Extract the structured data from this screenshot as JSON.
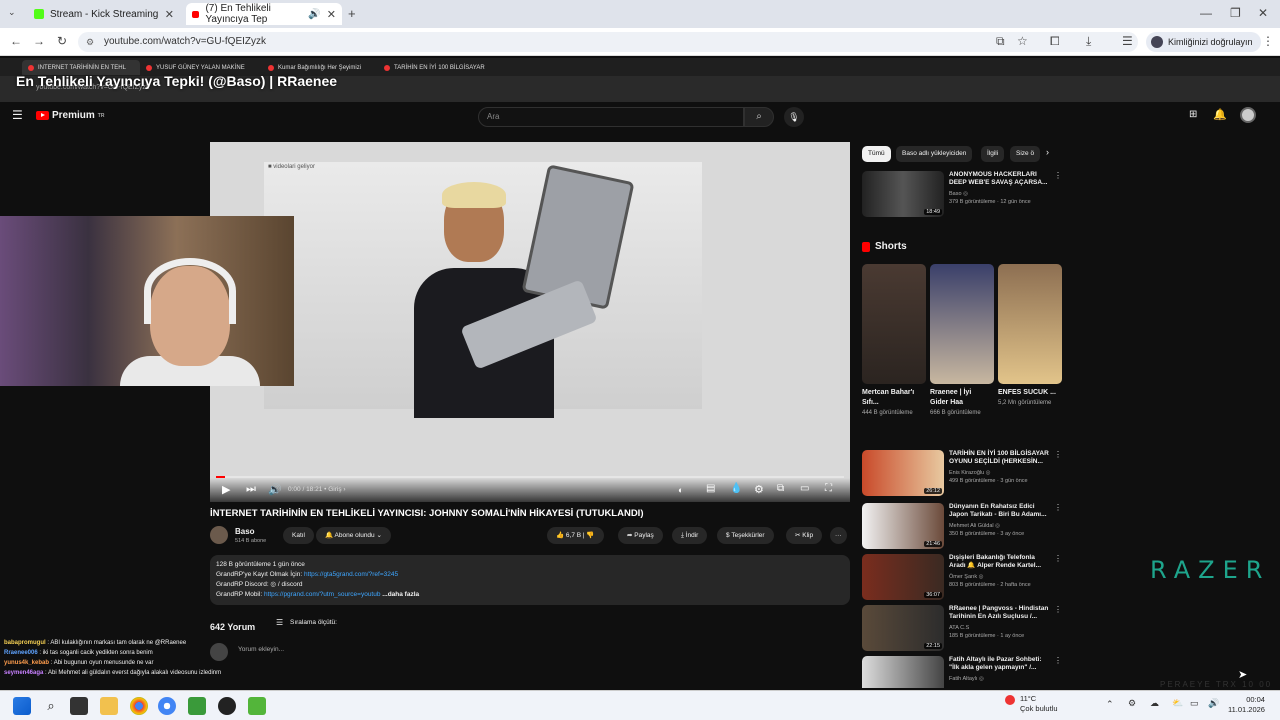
{
  "outer_browser": {
    "tabs": [
      {
        "label": "Stream - Kick Streaming"
      },
      {
        "label": "(7) En Tehlikeli Yayıncıya Tep"
      }
    ],
    "url": "youtube.com/watch?v=GU-fQEIZyzk",
    "signin_label": "Kimliğinizi doğrulayın"
  },
  "inner_browser": {
    "tabs": [
      {
        "label": "INTERNET TARİHİNİN EN TEHL"
      },
      {
        "label": "YUSUF GÜNEY YALAN MAKİNE"
      },
      {
        "label": "Kumar Bağımlılığı Her Şeyimizi"
      },
      {
        "label": "TARİHİN EN İYİ 100 BİLGİSAYAR"
      }
    ],
    "url": "youtube.com/watch?v=GU-fQEIZyzk"
  },
  "overlay_title": "En Tehlikeli Yayıncıya Tepki! (@Baso) | RRaenee",
  "youtube": {
    "logo_text": "Premium",
    "logo_sup": "TR",
    "search_placeholder": "Ara",
    "player": {
      "time": "0:00 / 18:21",
      "chapter": "• Giriş ›",
      "progress": 0.015,
      "watermark": "■ videolari geliyor"
    },
    "video": {
      "title": "İNTERNET TARİHİNİN EN TEHLİKELİ YAYINCISI: JOHNNY SOMALİ'NİN HİKAYESİ (TUTUKLANDI)",
      "channel": "Baso",
      "subs": "514 B abone",
      "join_label": "Katıl",
      "subscribed_label": "Abone olundu",
      "likes": "6,7 B",
      "share_label": "Paylaş",
      "download_label": "İndir",
      "thanks_label": "Teşekkürler",
      "clip_label": "Klip",
      "more_label": "···"
    },
    "description": {
      "stats": "128 B görüntüleme  1 gün önce",
      "line1_prefix": "GrandRP'ye Kayıt Olmak İçin: ",
      "line1_link": "https://gta5grand.com/?ref=3245",
      "line2": "GrandRP Discord:  ◎ / discord",
      "line3_prefix": "GrandRP Mobil: ",
      "line3_link": "https://pgrand.com/?utm_source=youtub",
      "more": "...daha fazla"
    },
    "comments": {
      "count": "642 Yorum",
      "sort_label": "Sıralama ölçütü:",
      "placeholder": "Yorum ekleyin..."
    },
    "filters": [
      "Tümü",
      "Baso adlı yükleyiciden",
      "İlgili",
      "Size ö"
    ],
    "sidebar_videos": [
      {
        "title": "ANONYMOUS HACKERLARI DEEP WEB'E SAVAŞ AÇARSA...",
        "channel": "Baso ◎",
        "meta": "379 B görüntüleme · 12 gün önce",
        "duration": "18:49"
      },
      {
        "title": "TARİHİN EN İYİ 100 BİLGİSAYAR OYUNU SEÇİLDİ (HERKESİN...",
        "channel": "Enis Kirazoğlu ◎",
        "meta": "499 B görüntüleme · 3 gün önce",
        "duration": "26:12"
      },
      {
        "title": "Dünyanın En Rahatsız Edici Japon Tarikatı - Biri Bu Adamı...",
        "channel": "Mehmet Ali Güldal ◎",
        "meta": "350 B görüntüleme · 3 ay önce",
        "duration": "21:46"
      },
      {
        "title": "Dışişleri Bakanlığı Telefonla Aradı 🔔 Alper Rende Kartel...",
        "channel": "Ömer Şarık ◎",
        "meta": "803 B görüntüleme · 2 hafta önce",
        "duration": "36:07"
      },
      {
        "title": "RRaenee | Pangvoss - Hindistan Tarihinin En Azılı Suçlusu /...",
        "channel": "ATA C.S",
        "meta": "185 B görüntüleme · 1 ay önce",
        "duration": "22:15"
      },
      {
        "title": "Fatih Altaylı ile Pazar Sohbeti: \"İlk akla gelen yapmayın\" /...",
        "channel": "Fatih Altaylı ◎",
        "meta": "",
        "duration": ""
      }
    ],
    "shorts_label": "Shorts",
    "shorts": [
      {
        "title": "Mertcan Bahar'ı Sıfı...",
        "views": "444 B görüntüleme"
      },
      {
        "title": "Rraenee | İyi Gider Haa",
        "views": "666 B görüntüleme"
      },
      {
        "title": "ENFES SUCUK ...",
        "views": "5,2 Mn görüntüleme"
      }
    ]
  },
  "chat": [
    {
      "user": "babapromugul",
      "text": " : ABI kulaklığının markası tam olarak ne @RRaenee",
      "color": "#f7d154"
    },
    {
      "user": "Rraenee006",
      "text": " : iki tas soganli cacik yedikten sonra benim",
      "color": "#5fa3ff"
    },
    {
      "user": "yunus4k_kebab",
      "text": " : Abi bugunun oyun menusunde ne var",
      "color": "#ff9d4d"
    },
    {
      "user": "seymen46aga",
      "text": " : Abi Mehmet ali güldalın everst dağıyla alakalı videosunu izledinm",
      "color": "#c780ff"
    }
  ],
  "razer": {
    "text": "RAZER",
    "sub": "PERAEYE TRX 10 00"
  },
  "taskbar": {
    "temp": "11°C",
    "weather": "Çok bulutlu",
    "time": "00:04",
    "date": "11.01.2026"
  },
  "colors": {
    "accent_red": "#ff0000",
    "link_blue": "#3ea6ff",
    "razer_green": "#1ea58c"
  }
}
